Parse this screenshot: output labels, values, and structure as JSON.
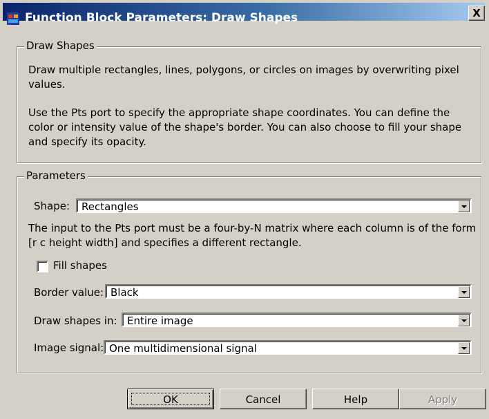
{
  "window": {
    "title": "Function Block Parameters: Draw Shapes",
    "close_glyph": "X",
    "icon": "simulink-block-icon"
  },
  "description_group": {
    "legend": "Draw Shapes",
    "paragraph1_line1": "Draw multiple rectangles, lines, polygons, or circles on images by overwriting pixel",
    "paragraph1_line2": "values.",
    "paragraph2_line1": "Use the Pts port to specify the appropriate shape coordinates. You can define the",
    "paragraph2_line2": "color or intensity value of the shape's border. You can also choose to fill your shape",
    "paragraph2_line3": "and specify its opacity."
  },
  "parameters_group": {
    "legend": "Parameters",
    "shape": {
      "label": "Shape:",
      "value": "Rectangles"
    },
    "shape_hint_line1": "The input to the Pts port must be a four-by-N matrix where each column is of the form",
    "shape_hint_line2": "[r c height width] and specifies a different rectangle.",
    "fill_shapes": {
      "label": "Fill shapes",
      "checked": false
    },
    "border_value": {
      "label": "Border value:",
      "value": "Black"
    },
    "draw_shapes_in": {
      "label": "Draw shapes in:",
      "value": "Entire image"
    },
    "image_signal": {
      "label": "Image signal:",
      "value": "One multidimensional signal"
    }
  },
  "buttons": {
    "ok": "OK",
    "cancel": "Cancel",
    "help": "Help",
    "apply": "Apply"
  }
}
